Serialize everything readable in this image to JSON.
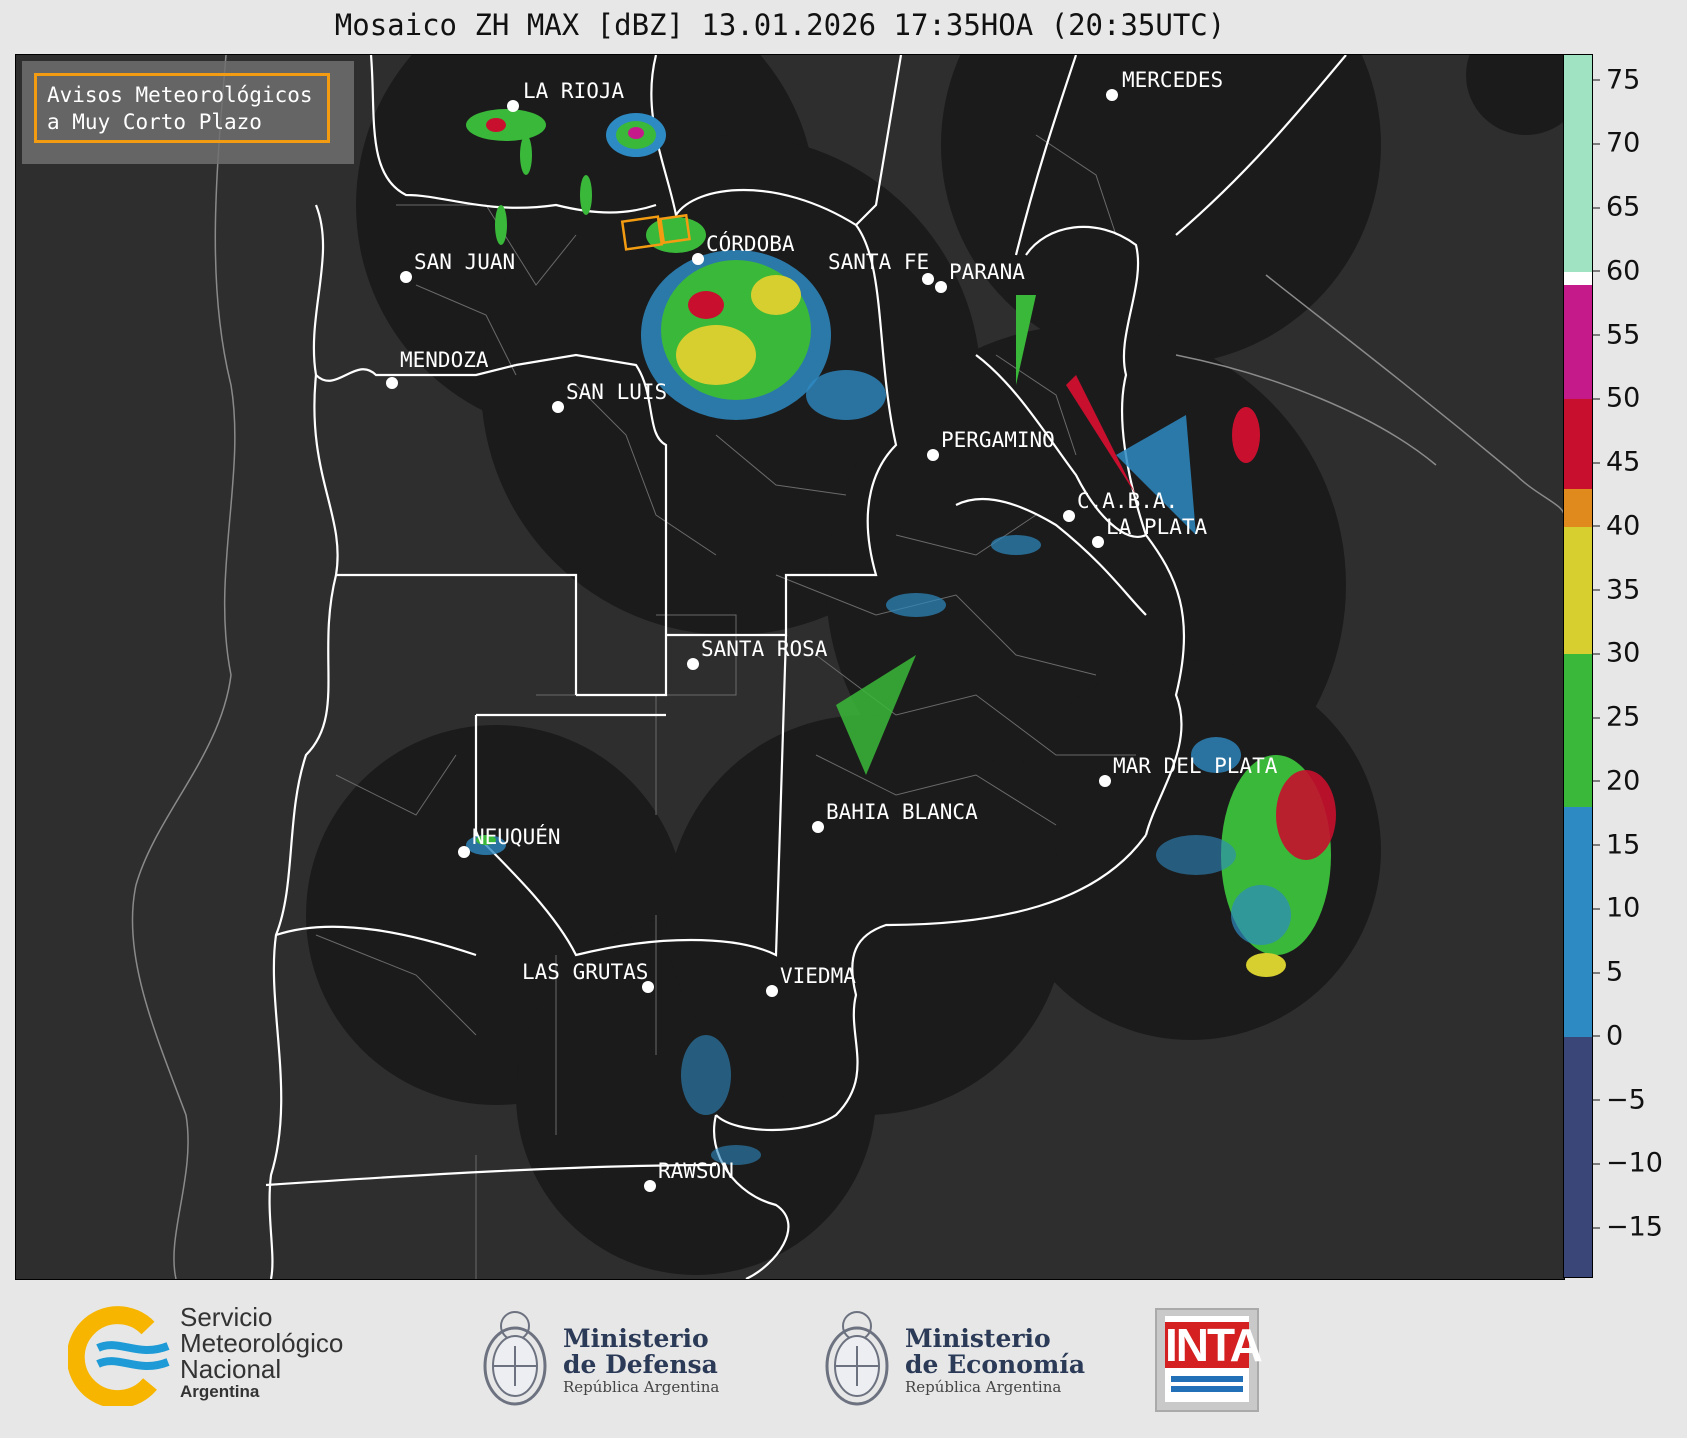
{
  "title": "Mosaico ZH MAX [dBZ] 13.01.2026 17:35HOA (20:35UTC)",
  "alert": {
    "line1": "Avisos Meteorológicos",
    "line2": "a Muy Corto Plazo",
    "border_color": "#f39c12"
  },
  "cities": [
    {
      "name": "LA RIOJA"
    },
    {
      "name": "CÓRDOBA"
    },
    {
      "name": "SAN JUAN"
    },
    {
      "name": "MENDOZA"
    },
    {
      "name": "SAN LUIS"
    },
    {
      "name": "SANTA FE"
    },
    {
      "name": "PARANA"
    },
    {
      "name": "MERCEDES"
    },
    {
      "name": "PERGAMINO"
    },
    {
      "name": "C.A.B.A."
    },
    {
      "name": "LA PLATA"
    },
    {
      "name": "SANTA ROSA"
    },
    {
      "name": "MAR DEL PLATA"
    },
    {
      "name": "BAHIA BLANCA"
    },
    {
      "name": "NEUQUÉN"
    },
    {
      "name": "LAS GRUTAS"
    },
    {
      "name": "VIEDMA"
    },
    {
      "name": "RAWSON"
    }
  ],
  "colorbar": {
    "unit": "dBZ",
    "min": -19,
    "max": 77,
    "ticks": [
      "75",
      "70",
      "65",
      "60",
      "55",
      "50",
      "45",
      "40",
      "35",
      "30",
      "25",
      "20",
      "15",
      "10",
      "5",
      "0",
      "−5",
      "−10",
      "−15"
    ],
    "tick_values": [
      75,
      70,
      65,
      60,
      55,
      50,
      45,
      40,
      35,
      30,
      25,
      20,
      15,
      10,
      5,
      0,
      -5,
      -10,
      -15
    ],
    "bands": [
      {
        "from": -19,
        "to": 0,
        "color": "#3a4678"
      },
      {
        "from": 0,
        "to": 18,
        "color": "#2e8ac2"
      },
      {
        "from": 18,
        "to": 30,
        "color": "#3ab83a"
      },
      {
        "from": 30,
        "to": 40,
        "color": "#d7cf2f"
      },
      {
        "from": 40,
        "to": 43,
        "color": "#e08a1e"
      },
      {
        "from": 43,
        "to": 50,
        "color": "#c8102e"
      },
      {
        "from": 50,
        "to": 59,
        "color": "#c51b8a"
      },
      {
        "from": 59,
        "to": 60,
        "color": "#ffffff"
      },
      {
        "from": 60,
        "to": 77,
        "color": "#9fe3c3"
      }
    ]
  },
  "logos": {
    "smn": {
      "line1": "Servicio",
      "line2": "Meteorológico",
      "line3": "Nacional",
      "sub": "Argentina"
    },
    "defensa": {
      "line1": "Ministerio",
      "line2": "de Defensa",
      "sub": "República Argentina"
    },
    "economia": {
      "line1": "Ministerio",
      "line2": "de Economía",
      "sub": "República Argentina"
    },
    "inta": {
      "word": "INTA"
    }
  },
  "colors": {
    "map_bg": "#2e2e2e",
    "radar_coverage": "#1b1b1b",
    "border": "#ffffff",
    "province": "#8a8a8a"
  }
}
